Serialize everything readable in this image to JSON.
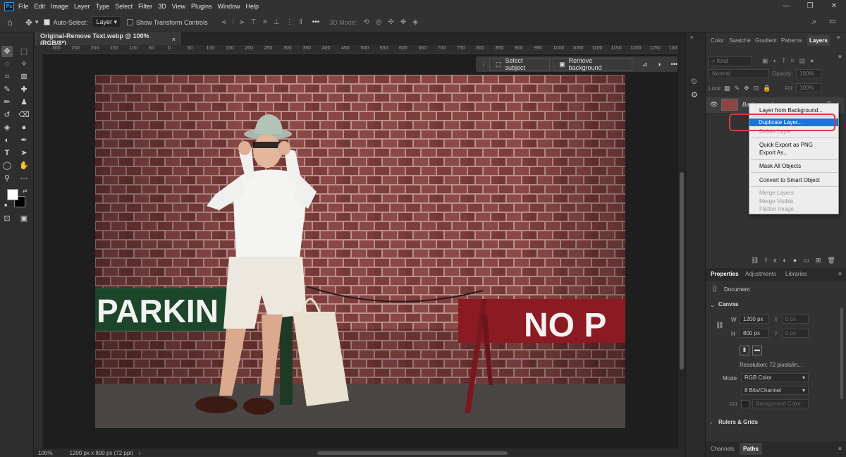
{
  "app": {
    "logo": "Ps"
  },
  "menu": [
    "File",
    "Edit",
    "Image",
    "Layer",
    "Type",
    "Select",
    "Filter",
    "3D",
    "View",
    "Plugins",
    "Window",
    "Help"
  ],
  "options": {
    "auto_select_label": "Auto-Select:",
    "auto_select_value": "Layer",
    "transform_label": "Show Transform Controls",
    "mode_3d": "3D Mode:",
    "more": "•••"
  },
  "document": {
    "tab_title": "Original-Remove Text.webp @ 100% (RGB/8*)",
    "close": "×",
    "zoom": "100%",
    "dims": "1200 px x 800 px (72 ppi)",
    "status_arrow": "›"
  },
  "ruler_ticks": [
    "300",
    "250",
    "200",
    "150",
    "100",
    "50",
    "0",
    "50",
    "100",
    "150",
    "200",
    "250",
    "300",
    "350",
    "400",
    "450",
    "500",
    "550",
    "600",
    "650",
    "700",
    "750",
    "800",
    "850",
    "900",
    "950",
    "1000",
    "1050",
    "1100",
    "1150",
    "1200",
    "1250",
    "130"
  ],
  "contextual_taskbar": {
    "select_subject": "Select subject",
    "remove_background": "Remove background",
    "more": "•••"
  },
  "photo": {
    "sign_left": "PARKIN",
    "sign_right": "NO P"
  },
  "panel_tabs": [
    "Color",
    "Swatche",
    "Gradient",
    "Patterns",
    "Layers"
  ],
  "layers": {
    "kind": "Kind",
    "blend": "Normal",
    "opacity_label": "Opacity:",
    "opacity": "100%",
    "lock_label": "Lock:",
    "fill_label": "Fill:",
    "fill": "100%",
    "layer_name": "Background"
  },
  "context_menu": {
    "items": [
      {
        "label": "Layer from Background...",
        "disabled": false
      },
      {
        "label": "Duplicate Layer...",
        "disabled": false,
        "highlighted": true
      },
      {
        "label": "Delete Layer",
        "disabled": true
      },
      {
        "label": "Quick Export as PNG",
        "disabled": false
      },
      {
        "label": "Export As...",
        "disabled": false
      },
      {
        "label": "Mask All Objects",
        "disabled": false
      },
      {
        "label": "Convert to Smart Object",
        "disabled": false
      },
      {
        "label": "Merge Layers",
        "disabled": true
      },
      {
        "label": "Merge Visible",
        "disabled": true
      },
      {
        "label": "Flatten Image",
        "disabled": true
      }
    ]
  },
  "properties": {
    "tabs": [
      "Properties",
      "Adjustments",
      "Libraries"
    ],
    "doc_label": "Document",
    "canvas_label": "Canvas",
    "w_label": "W",
    "w": "1200 px",
    "h_label": "H",
    "h": "800 px",
    "x_label": "X",
    "y_label": "Y",
    "x": "0 px",
    "y": "0 px",
    "resolution": "Resolution: 72 pixels/in...",
    "mode_label": "Mode",
    "mode": "RGB Color",
    "depth": "8 Bits/Channel",
    "fill_label": "Fill",
    "fill": "Background Color",
    "rulers_label": "Rulers & Grids"
  },
  "bottom_tabs": [
    "Channels",
    "Paths"
  ],
  "colors": {
    "highlight": "#1c74d4",
    "annotation": "#e0383a",
    "panel": "#323232",
    "app_bg": "#282828"
  }
}
